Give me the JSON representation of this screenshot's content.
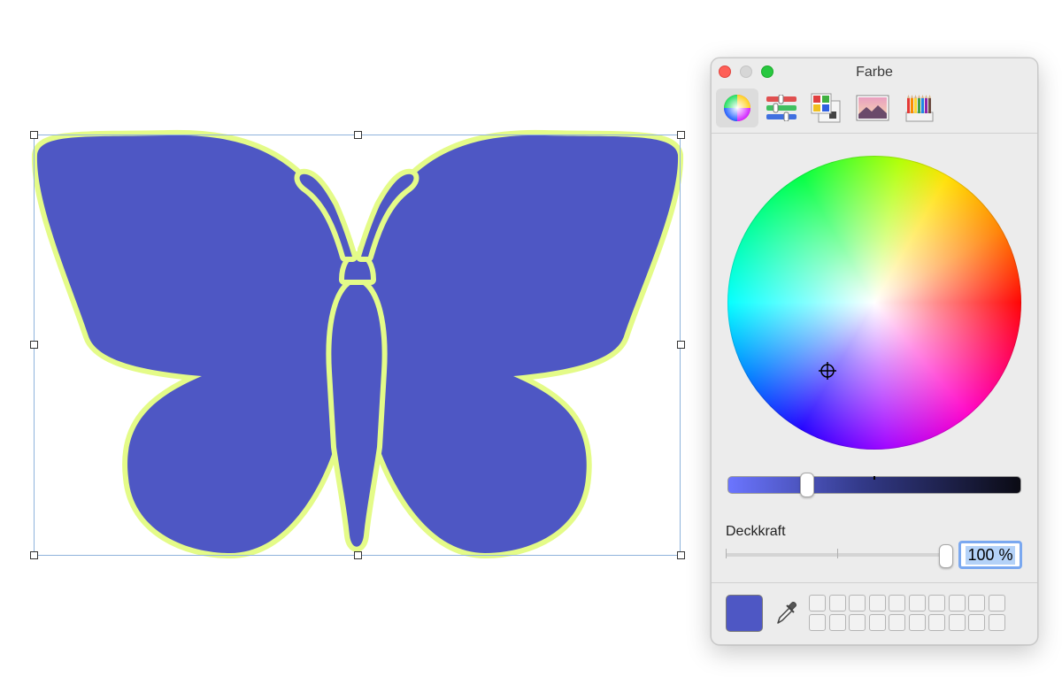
{
  "window": {
    "title": "Farbe"
  },
  "tabs": [
    {
      "icon": "color-wheel-icon",
      "active": true
    },
    {
      "icon": "color-sliders-icon",
      "active": false
    },
    {
      "icon": "color-palettes-icon",
      "active": false
    },
    {
      "icon": "image-palettes-icon",
      "active": false
    },
    {
      "icon": "pencils-icon",
      "active": false
    }
  ],
  "opacity": {
    "label": "Deckkraft",
    "value": "100 %",
    "level": 1.0
  },
  "brightness": {
    "level": 0.28
  },
  "colors": {
    "fill": "#4e57c4",
    "stroke": "#e4fb88",
    "selection": "#8fb3dc"
  }
}
